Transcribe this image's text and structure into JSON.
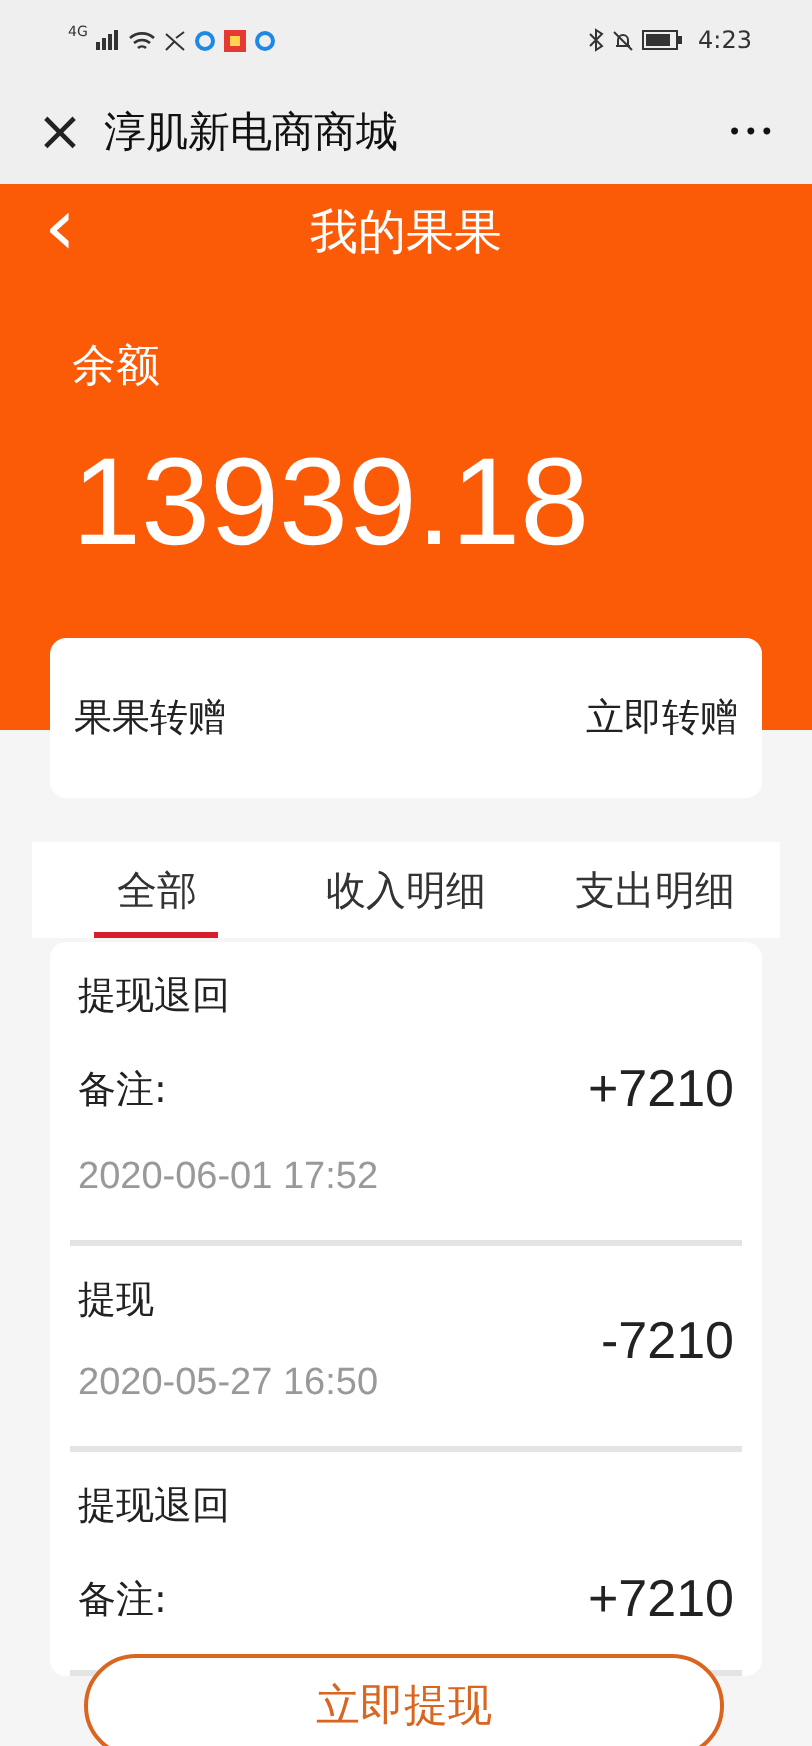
{
  "status_bar": {
    "network": "4G",
    "time": "4:23"
  },
  "app_bar": {
    "close": "×",
    "title": "淳肌新电商商城",
    "more": "•••"
  },
  "header": {
    "back": "‹",
    "title": "我的果果",
    "balance_label": "余额",
    "balance": "13939.18"
  },
  "transfer_card": {
    "label": "果果转赠",
    "action": "立即转赠"
  },
  "tabs": [
    {
      "label": "全部",
      "selected": true
    },
    {
      "label": "收入明细",
      "selected": false
    },
    {
      "label": "支出明细",
      "selected": false
    }
  ],
  "records": [
    {
      "title": "提现退回",
      "note": "备注:",
      "amount": "+7210",
      "time": "2020-06-01 17:52"
    },
    {
      "title": "提现",
      "amount": "-7210",
      "time": "2020-05-27 16:50"
    },
    {
      "title": "提现退回",
      "note": "备注:",
      "amount": "+7210"
    }
  ],
  "withdraw_button": "立即提现"
}
